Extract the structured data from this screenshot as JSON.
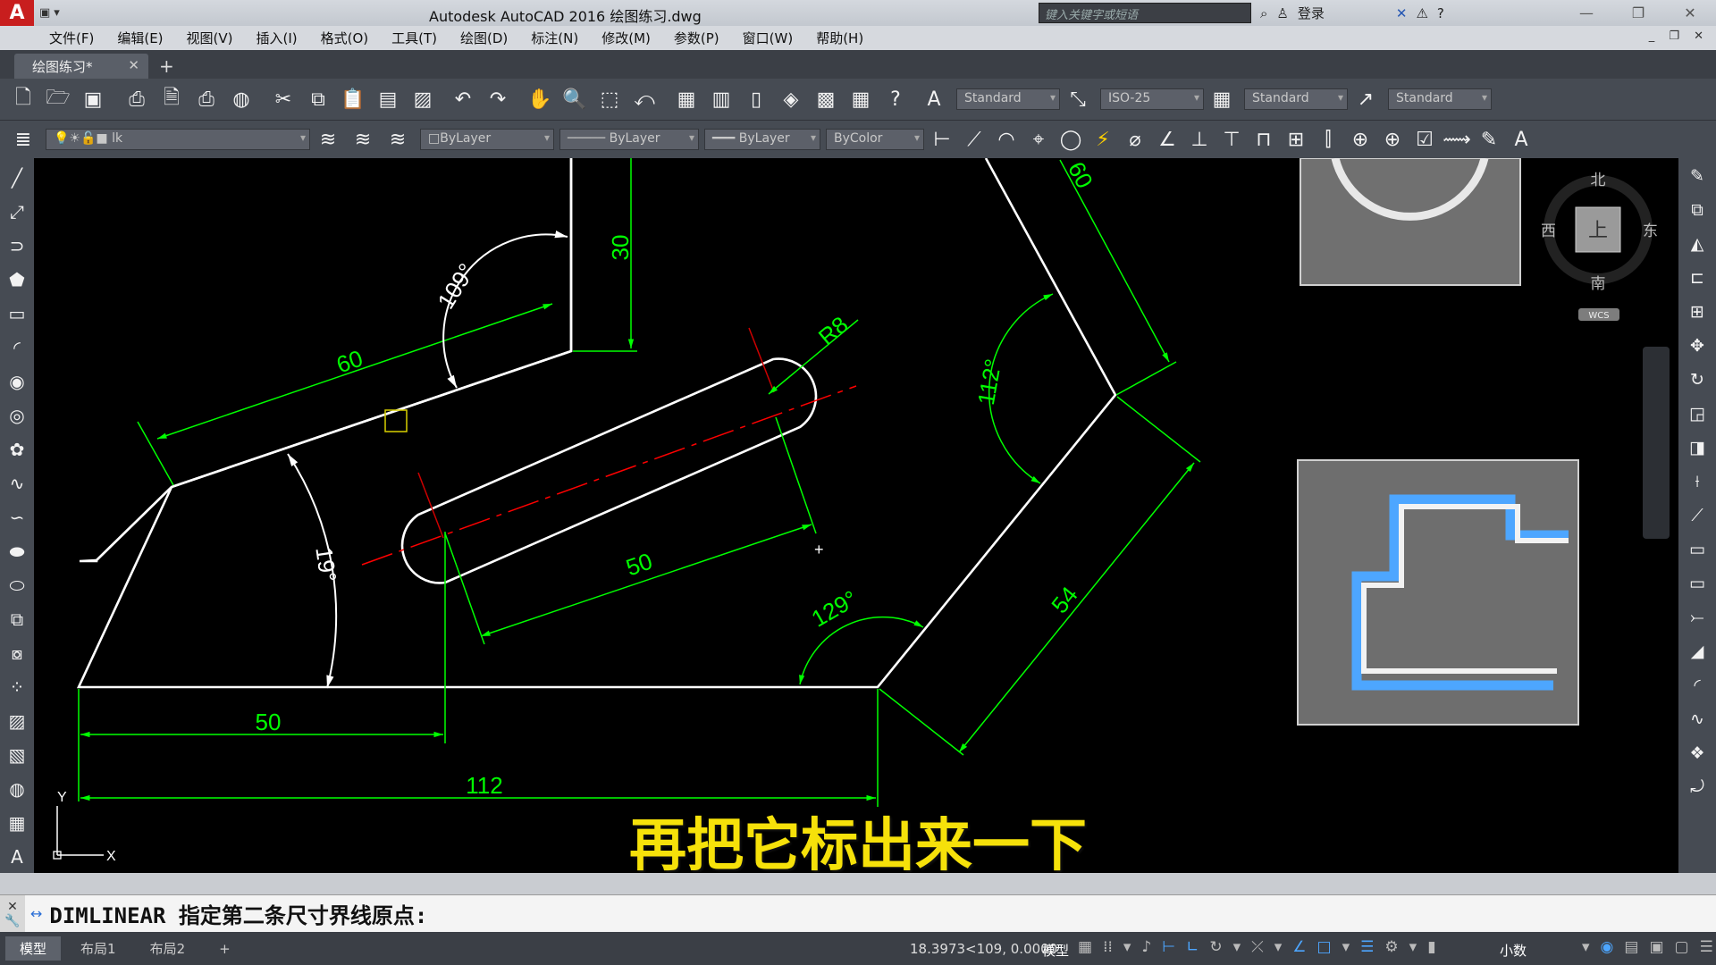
{
  "titlebar": {
    "logo": "A",
    "quick_access": [
      "▣",
      "▾"
    ],
    "title": "Autodesk AutoCAD 2016    绘图练习.dwg",
    "search_placeholder": "键入关键字或短语",
    "signin": "登录",
    "window_controls": [
      "—",
      "❐",
      "✕"
    ]
  },
  "menu": [
    "文件(F)",
    "编辑(E)",
    "视图(V)",
    "插入(I)",
    "格式(O)",
    "工具(T)",
    "绘图(D)",
    "标注(N)",
    "修改(M)",
    "参数(P)",
    "窗口(W)",
    "帮助(H)"
  ],
  "menu_right": "_ ❐ ✕",
  "tabs": {
    "active": "绘图练习*",
    "close": "✕",
    "add": "+"
  },
  "toolbar1": {
    "icons": [
      "new-icon",
      "open-icon",
      "save-icon",
      "print-icon",
      "preview-icon",
      "plot-icon",
      "publish-icon",
      "cut-icon",
      "copy-icon",
      "paste-icon",
      "match-icon",
      "block-icon",
      "undo-icon",
      "redo-icon",
      "pan-icon",
      "zoom-realtime-icon",
      "zoom-window-icon",
      "zoom-previous-icon",
      "properties-icon",
      "design-center-icon",
      "tool-palette-icon",
      "sheet-set-icon",
      "markup-icon",
      "calculator-icon",
      "help-icon"
    ],
    "text_style": "Standard",
    "dim_style": "ISO-25",
    "table_style": "Standard",
    "mleader_style": "Standard"
  },
  "toolbar2": {
    "layer_value": "lk",
    "color": "ByLayer",
    "linetype": "ByLayer",
    "lineweight": "ByLayer",
    "plotstyle": "ByColor"
  },
  "left_tools": [
    "line-icon",
    "construction-line-icon",
    "polyline-icon",
    "polygon-icon",
    "rectangle-icon",
    "arc-icon",
    "circle-icon",
    "donut-icon",
    "cloud-icon",
    "spline-icon",
    "spline-fit-icon",
    "ellipse-icon",
    "ellipse-arc-icon",
    "insert-block-icon",
    "make-block-icon",
    "point-icon",
    "hatch-icon",
    "gradient-icon",
    "region-icon",
    "table-icon",
    "mtext-icon"
  ],
  "right_tools": [
    "erase-icon",
    "copy-object-icon",
    "mirror-icon",
    "offset-icon",
    "array-icon",
    "move-icon",
    "rotate-icon",
    "scale-icon",
    "stretch-icon",
    "trim-icon",
    "extend-icon",
    "break-point-icon",
    "break-icon",
    "join-icon",
    "chamfer-icon",
    "fillet-icon",
    "blend-icon",
    "explode-icon",
    "edit-polyline-icon"
  ],
  "viewcube": {
    "north": "北",
    "south": "南",
    "east": "东",
    "west": "西",
    "face": "上",
    "wcs": "WCS"
  },
  "ucs": {
    "x": "X",
    "y": "Y"
  },
  "dimensions": {
    "d30": "30",
    "d109": "109°",
    "d60_left": "60",
    "r8": "R8",
    "d60_right": "60",
    "d112_angle": "112°",
    "d19": "19°",
    "d50_slot": "50",
    "d129": "129°",
    "d54": "54",
    "d50_bottom": "50",
    "d112_bottom": "112"
  },
  "caption": "再把它标出来一下",
  "command": {
    "close": "✕",
    "settings": "🔧",
    "prompt": "DIMLINEAR 指定第二条尺寸界线原点:"
  },
  "status": {
    "tabs": [
      "模型",
      "布局1",
      "布局2"
    ],
    "add": "+",
    "coordinates": "18.3973<109, 0.0000",
    "space": "模型",
    "units": "小数"
  },
  "colors": {
    "accent_green": "#00ff00",
    "outline_white": "#ffffff",
    "centerline_red": "#ff0000",
    "caption_yellow": "#f6e10a",
    "preview_blue": "#4da6ff"
  }
}
